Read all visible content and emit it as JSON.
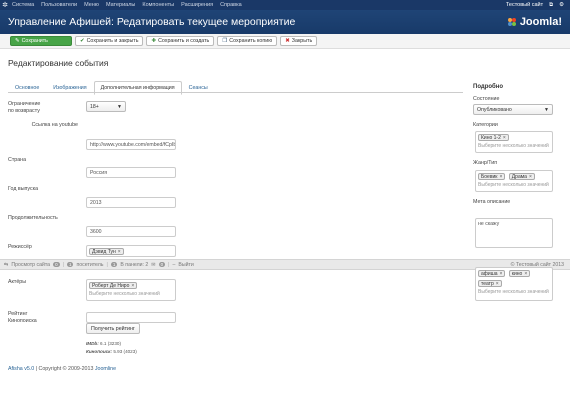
{
  "topnav": {
    "menu": [
      "Система",
      "Пользователи",
      "Меню",
      "Материалы",
      "Компоненты",
      "Расширения",
      "Справка"
    ],
    "site_name": "Тестовый сайт",
    "gear": "⚙"
  },
  "header": {
    "title": "Управление Афишей: Редатировать текущее мероприятие",
    "brand": "Joomla!"
  },
  "toolbar": {
    "save": "Сохранить",
    "save_close": "Сохранить и закрыть",
    "save_new": "Сохранить и создать",
    "save_copy": "Сохранить копию",
    "close": "Закрыть"
  },
  "page_title": "Редактирование события",
  "tabs": [
    "Основное",
    "Изображения",
    "Дополнительная информация",
    "Сеансы"
  ],
  "form": {
    "age_label": "Ограничение по возврасту",
    "age_value": "18+",
    "youtube_label": "Ссылка на youtube",
    "youtube_value": "http://www.youtube.com/embed/fCpIbk",
    "country_label": "Страна",
    "country_value": "Россия",
    "year_label": "Год выпуска",
    "year_value": "2013",
    "duration_label": "Продолжительность",
    "duration_value": "3600",
    "director_label": "Режиссёр",
    "director_value": "Дэвид Тун",
    "actors_label": "Актёры",
    "actors_chip": "Роберт Де Ниро",
    "actors_placeholder": "Выберите несколько значений",
    "kp_label": "Рейтинг Кинопоиска",
    "kp_value": "",
    "get_rating": "Получить рейтинг",
    "imdb_label": "IMDb:",
    "imdb_value": "6.1 (3230)",
    "kinopoisk_label": "Кинопоиск:",
    "kinopoisk_value": "5.93 (4023)"
  },
  "sidebar": {
    "title": "Подробно",
    "state_label": "Состояние",
    "state_value": "Опубликовано",
    "category_label": "Категории",
    "category_chip": "Кино 1-2",
    "category_placeholder": "Выберите несколько значений",
    "genre_label": "Жанр/Тип",
    "genre_chips": [
      "Боевик",
      "Драма"
    ],
    "genre_placeholder": "Выберите несколько значений",
    "meta_label": "Мета описание",
    "meta_value": "не скажу",
    "tags_chips": [
      "афиша",
      "кино",
      "театр"
    ],
    "tags_placeholder": "Выберите несколько значений"
  },
  "statusbar": {
    "view_site": "Просмотр сайта",
    "view_site_count": "0",
    "visitors": "посетитель",
    "visitors_count": "1",
    "admins_count": "1",
    "admins": "В панели: 2",
    "messages_count": "0",
    "logout": "Выйти",
    "copyright": "© Тестовый сайт 2013"
  },
  "footer": {
    "version_link": "Afisha v5.0",
    "copyright": " | Copyright © 2009-2013 ",
    "joomline_link": "Joomline"
  },
  "colors": {
    "topnav_bg": "#1a3867",
    "header_bg": "#1f4476",
    "save_green": "#47a447",
    "link_blue": "#2a6496"
  }
}
